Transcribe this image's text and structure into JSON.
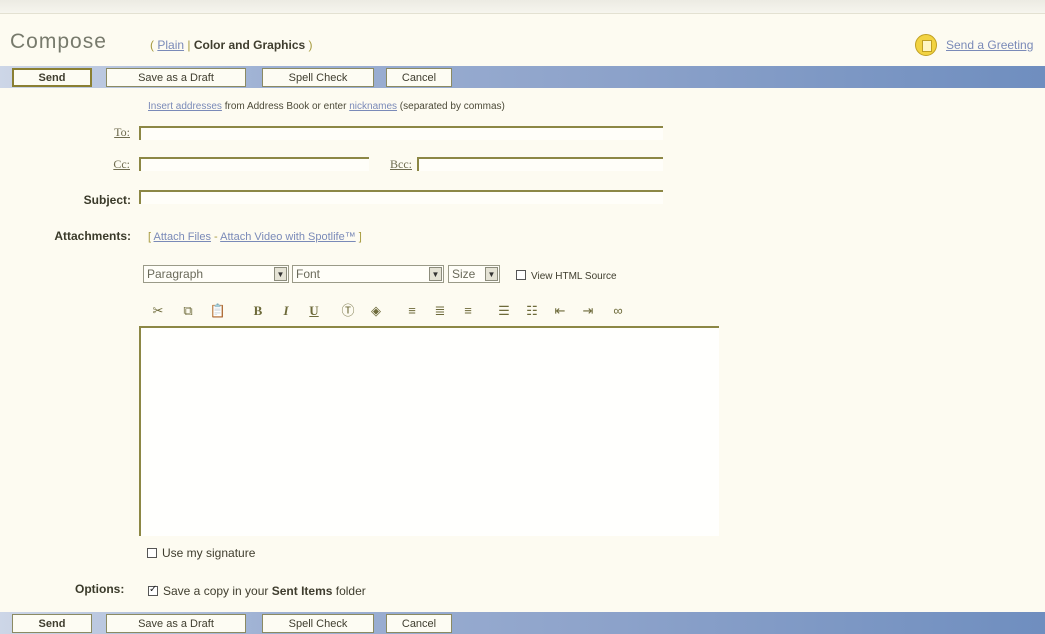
{
  "header": {
    "title": "Compose",
    "mode_open": "(",
    "mode_plain": "Plain",
    "mode_sep": "|",
    "mode_color": "Color and Graphics",
    "mode_close": ")",
    "greeting_link": "Send a Greeting",
    "greeting_icon": "greeting-card-icon"
  },
  "toolbar_buttons": {
    "send": "Send",
    "save_draft": "Save as a Draft",
    "spell_check": "Spell Check",
    "cancel": "Cancel"
  },
  "address_hint": {
    "link1": "Insert addresses",
    "text1": " from Address Book or enter ",
    "link2": "nicknames",
    "text2": " (separated by commas)"
  },
  "fields": {
    "to_label": "To:",
    "to_value": "",
    "cc_label": "Cc:",
    "cc_value": "",
    "bcc_label": "Bcc:",
    "bcc_value": "",
    "subject_label": "Subject:",
    "subject_value": ""
  },
  "attachments": {
    "label": "Attachments:",
    "open": "[",
    "attach_files": "Attach Files",
    "sep": " - ",
    "attach_video": "Attach Video with Spotlife™",
    "close": "]"
  },
  "format": {
    "paragraph": "Paragraph",
    "font": "Font",
    "size": "Size",
    "view_html": "View HTML Source"
  },
  "format_icons": [
    "cut-icon",
    "copy-icon",
    "paste-icon",
    "bold-icon",
    "italic-icon",
    "underline-icon",
    "text-color-icon",
    "highlight-icon",
    "align-left-icon",
    "align-center-icon",
    "align-right-icon",
    "numbered-list-icon",
    "bulleted-list-icon",
    "outdent-icon",
    "indent-icon",
    "insert-link-icon"
  ],
  "format_glyphs": {
    "bold": "B",
    "italic": "I",
    "underline": "U"
  },
  "editor": {
    "body": ""
  },
  "signature": {
    "label": "Use my signature",
    "checked": false
  },
  "options": {
    "label": "Options:",
    "copy_text1": "Save a copy in your ",
    "copy_bold": "Sent Items",
    "copy_text2": " folder",
    "checked": true
  },
  "colors": {
    "button_bar_start": "#cdd6e7",
    "button_bar_end": "#6f8ebf",
    "field_border": "#8c8745",
    "link": "#7a8ab8"
  }
}
